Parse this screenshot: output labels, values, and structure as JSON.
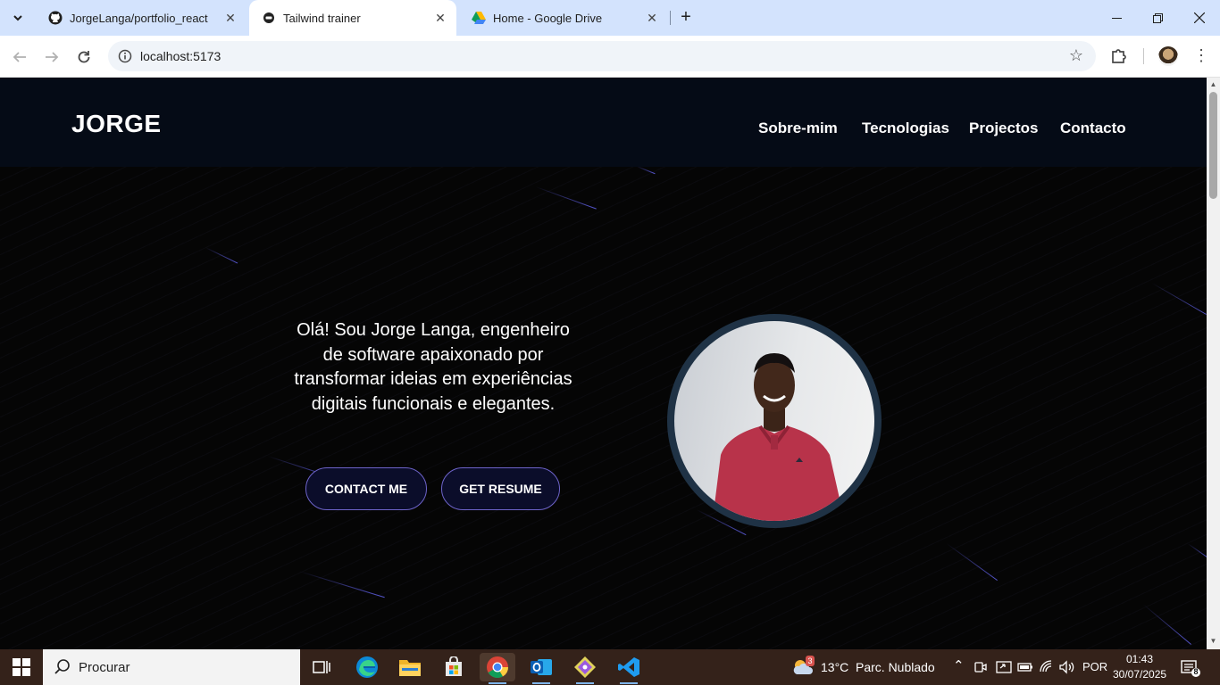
{
  "browser": {
    "tabs": [
      {
        "title": "JorgeLanga/portfolio_react",
        "icon": "github-icon",
        "active": false
      },
      {
        "title": "Tailwind trainer",
        "icon": "site-favicon",
        "active": true
      },
      {
        "title": "Home - Google Drive",
        "icon": "google-drive-icon",
        "active": false
      }
    ],
    "url": "localhost:5173"
  },
  "site": {
    "logo": "JORGE",
    "nav": [
      "Sobre-mim",
      "Tecnologias",
      "Projectos",
      "Contacto"
    ],
    "hero": {
      "intro": "Olá! Sou Jorge Langa, engenheiro de software apaixonado por transformar ideias em experiências digitais funcionais e elegantes.",
      "contact_button": "CONTACT ME",
      "resume_button": "GET RESUME"
    },
    "colors": {
      "nav_bg": "#050b16",
      "button_border": "#6d63c9",
      "avatar_ring": "#1f3245"
    }
  },
  "taskbar": {
    "search_placeholder": "Procurar",
    "weather_temp": "13°C",
    "weather_desc": "Parc. Nublado",
    "weather_badge": "3",
    "language": "POR",
    "time": "01:43",
    "date": "30/07/2025",
    "notification_count": "8",
    "apps": [
      "task-view-icon",
      "edge-icon",
      "file-explorer-icon",
      "store-icon",
      "chrome-icon",
      "outlook-icon",
      "git-icon",
      "vscode-icon"
    ]
  }
}
